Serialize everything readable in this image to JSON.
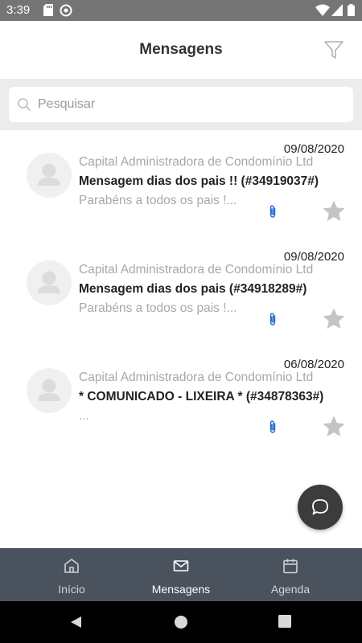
{
  "status_bar": {
    "time": "3:39"
  },
  "header": {
    "title": "Mensagens"
  },
  "search": {
    "placeholder": "Pesquisar"
  },
  "messages": [
    {
      "date": "09/08/2020",
      "sender": "Capital Administradora de Condomínio Ltd",
      "subject": "Mensagem dias dos pais !! (#34919037#)",
      "preview": "Parabéns a todos os pais !...",
      "has_attachment": true,
      "starred": false
    },
    {
      "date": "09/08/2020",
      "sender": "Capital Administradora de Condomínio Ltd",
      "subject": "Mensagem dias dos pais (#34918289#)",
      "preview": "Parabéns a todos os pais !...",
      "has_attachment": true,
      "starred": false
    },
    {
      "date": "06/08/2020",
      "sender": "Capital Administradora de Condomínio Ltd",
      "subject": "* COMUNICADO - LIXEIRA * (#34878363#)",
      "preview": "...",
      "has_attachment": true,
      "starred": false
    }
  ],
  "bottom_nav": {
    "items": [
      {
        "label": "Início",
        "icon": "home-icon",
        "active": false
      },
      {
        "label": "Mensagens",
        "icon": "mail-icon",
        "active": true
      },
      {
        "label": "Agenda",
        "icon": "calendar-icon",
        "active": false
      }
    ]
  },
  "colors": {
    "status_bar": "#757575",
    "bottom_nav": "#4a525d",
    "fab": "#3c3c3c",
    "attachment": "#2a6fd6",
    "star": "#c4c4c4",
    "muted_text": "#a8a8a8"
  }
}
